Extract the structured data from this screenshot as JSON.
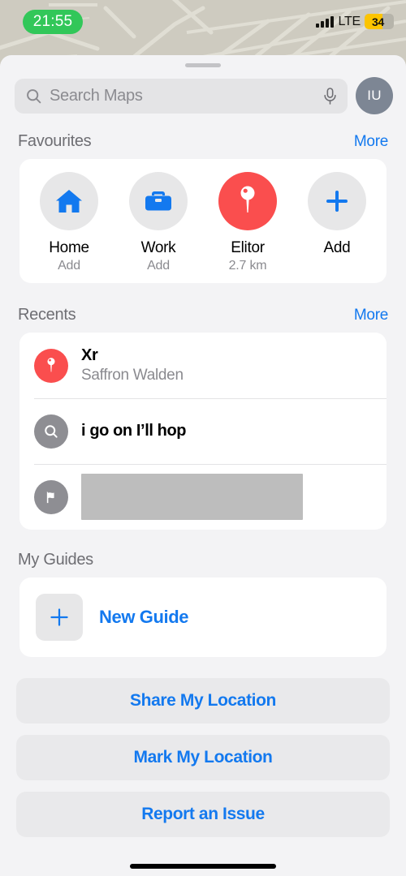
{
  "status_bar": {
    "time": "21:55",
    "time_pill_color": "#32c759",
    "network": "LTE",
    "battery_percent": "34",
    "battery_color": "#fcc400",
    "signal_icon": "cellular-bars-icon"
  },
  "sheet": {
    "grabber": "sheet-grabber"
  },
  "search": {
    "placeholder": "Search Maps",
    "search_icon": "search-icon",
    "mic_icon": "microphone-icon",
    "avatar_initials": "IU"
  },
  "favourites": {
    "title": "Favourites",
    "more_label": "More",
    "items": [
      {
        "label": "Home",
        "sub": "Add",
        "icon": "house-icon",
        "style": "gray"
      },
      {
        "label": "Work",
        "sub": "Add",
        "icon": "briefcase-icon",
        "style": "gray"
      },
      {
        "label": "Elitor",
        "sub": "2.7 km",
        "icon": "map-pin-icon",
        "style": "red"
      },
      {
        "label": "Add",
        "sub": "",
        "icon": "plus-icon",
        "style": "gray"
      }
    ]
  },
  "recents": {
    "title": "Recents",
    "more_label": "More",
    "items": [
      {
        "title": "Xr",
        "sub": "Saffron Walden",
        "icon": "map-pin-icon",
        "icon_style": "red",
        "redacted": false
      },
      {
        "title": "i go on I’ll hop",
        "sub": "",
        "icon": "search-icon",
        "icon_style": "gray",
        "redacted": false
      },
      {
        "title": "",
        "sub": "",
        "icon": "flag-icon",
        "icon_style": "gray",
        "redacted": true
      }
    ]
  },
  "guides": {
    "title": "My Guides",
    "new_guide_label": "New Guide",
    "new_guide_icon": "plus-icon"
  },
  "actions": [
    {
      "label": "Share My Location"
    },
    {
      "label": "Mark My Location"
    },
    {
      "label": "Report an Issue"
    }
  ],
  "colors": {
    "accent_blue": "#1379ef",
    "accent_red": "#fa4e4e",
    "map_background": "#cecbc0",
    "sheet_background": "#f3f3f5",
    "card_background": "#ffffff"
  }
}
